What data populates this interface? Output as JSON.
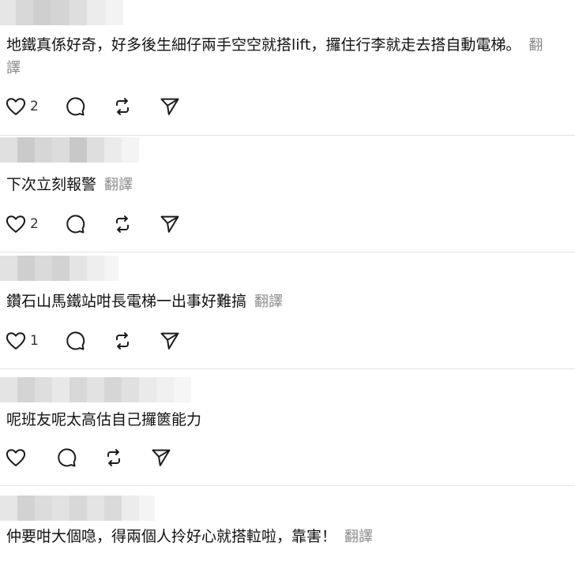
{
  "posts": [
    {
      "text": "地鐵真係好奇，好多後生細仔兩手空空就搭lift，攞住行李就走去搭自動電梯。",
      "translate_label": "翻譯",
      "likes": "2"
    },
    {
      "text": "下次立刻報警",
      "translate_label": "翻譯",
      "likes": "2"
    },
    {
      "text": "鑽石山馬鐵站咁長電梯一出事好難搞",
      "translate_label": "翻譯",
      "likes": "1"
    },
    {
      "text": "呢班友呢太高估自己攞篋能力",
      "translate_label": "",
      "likes": ""
    },
    {
      "text": "仲要咁大個喼，得兩個人拎好心就搭𨋢啦，靠害！",
      "translate_label": "翻譯",
      "likes": ""
    }
  ],
  "icons": {
    "like": "heart-icon",
    "reply": "comment-bubble-icon",
    "repost": "repost-arrows-icon",
    "share": "send-paper-plane-icon"
  },
  "colors": {
    "text": "#111111",
    "muted": "#8a8a8a",
    "divider": "#e3e3e3",
    "icon": "#1a1a1a"
  }
}
